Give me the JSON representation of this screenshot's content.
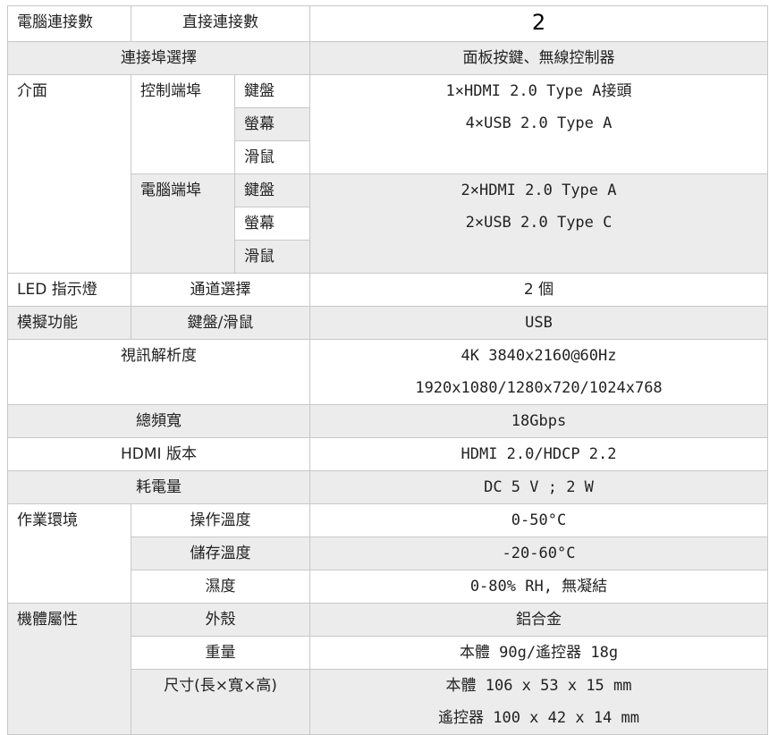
{
  "rows": {
    "computers": {
      "label": "電腦連接數",
      "sub": "直接連接數",
      "value": "2"
    },
    "ports_select": {
      "label": "連接埠選擇",
      "value": "面板按鍵、無線控制器"
    },
    "interface": {
      "label": "介面",
      "control_port": {
        "label": "控制端埠",
        "items": [
          "鍵盤",
          "螢幕",
          "滑鼠"
        ],
        "values": [
          "1×HDMI 2.0 Type A接頭",
          "4×USB 2.0 Type A"
        ]
      },
      "pc_port": {
        "label": "電腦端埠",
        "items": [
          "鍵盤",
          "螢幕",
          "滑鼠"
        ],
        "values": [
          "2×HDMI 2.0 Type A",
          "2×USB 2.0 Type C"
        ]
      }
    },
    "led": {
      "label": "LED 指示燈",
      "sub": "通道選擇",
      "value": "2 個"
    },
    "emulation": {
      "label": "模擬功能",
      "sub": "鍵盤/滑鼠",
      "value": "USB"
    },
    "video": {
      "label": "視訊解析度",
      "values": [
        "4K 3840x2160@60Hz",
        "1920x1080/1280x720/1024x768"
      ]
    },
    "bandwidth": {
      "label": "總頻寬",
      "value": "18Gbps"
    },
    "hdmi": {
      "label": "HDMI 版本",
      "value": "HDMI 2.0/HDCP 2.2"
    },
    "power": {
      "label": "耗電量",
      "value": "DC 5 V ; 2 W"
    },
    "environment": {
      "label": "作業環境",
      "items": [
        {
          "label": "操作溫度",
          "value": "0-50°C"
        },
        {
          "label": "儲存溫度",
          "value": "-20-60°C"
        },
        {
          "label": "濕度",
          "value": "0-80% RH, 無凝結"
        }
      ]
    },
    "physical": {
      "label": "機體屬性",
      "housing": {
        "label": "外殼",
        "value": "鋁合金"
      },
      "weight": {
        "label": "重量",
        "value": "本體 90g/遙控器 18g"
      },
      "dimensions": {
        "label": "尺寸(長×寬×高)",
        "values": [
          "本體 106 x 53 x 15 mm",
          "遙控器 100 x 42 x 14 mm"
        ]
      }
    }
  }
}
